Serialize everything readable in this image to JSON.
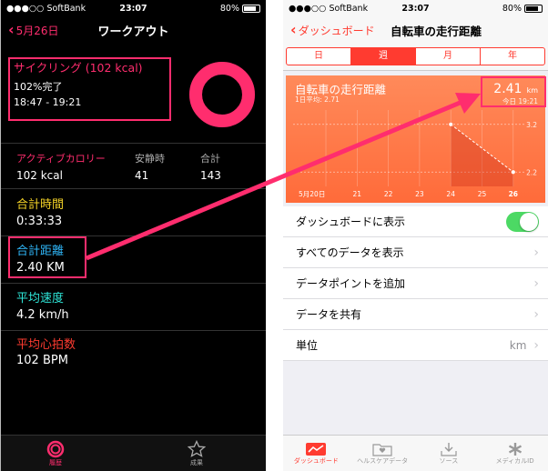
{
  "left": {
    "status": {
      "carrier": "●●●○○ SoftBank",
      "time": "23:07",
      "battery": "80%"
    },
    "nav": {
      "back": "5月26日",
      "title": "ワークアウト"
    },
    "workout": {
      "title": "サイクリング (102 kcal)",
      "completion": "102%完了",
      "time_range": "18:47 - 19:21",
      "ring_fraction": 1.02
    },
    "calories": {
      "h1": "アクティブカロリー",
      "h2": "安静時",
      "h3": "合計",
      "v1": "102 kcal",
      "v2": "41",
      "v3": "143"
    },
    "stats": [
      {
        "label": "合計時間",
        "value": "0:33:33",
        "color": "#f5d327"
      },
      {
        "label": "合計距離",
        "value": "2.40 KM",
        "color": "#2fb4f5"
      },
      {
        "label": "平均速度",
        "value": "4.2 km/h",
        "color": "#2ee6d8"
      },
      {
        "label": "平均心拍数",
        "value": "102 BPM",
        "color": "#ff3b30"
      }
    ],
    "tabs": {
      "history": "履歴",
      "achievements": "成果"
    }
  },
  "right": {
    "status": {
      "carrier": "●●●○○ SoftBank",
      "time": "23:07",
      "battery": "80%"
    },
    "nav": {
      "back": "ダッシュボード",
      "title": "自転車の走行距離"
    },
    "segments": [
      "日",
      "週",
      "月",
      "年"
    ],
    "segment_selected": "週",
    "card": {
      "title": "自転車の走行距離",
      "subtitle": "1日平均: 2.71",
      "value": "2.41",
      "unit": "km",
      "timestamp": "今日 19:21"
    },
    "chart_data": {
      "type": "line",
      "x": [
        "5月20日",
        "21",
        "22",
        "23",
        "24",
        "25",
        "26"
      ],
      "points": [
        {
          "x": "24",
          "y": 3.2
        },
        {
          "x": "26",
          "y": 2.2
        }
      ],
      "y_ticks": [
        "3.2",
        "2.2"
      ],
      "ylim": [
        1.9,
        3.5
      ]
    },
    "rows": [
      {
        "label": "ダッシュボードに表示",
        "type": "toggle"
      },
      {
        "label": "すべてのデータを表示",
        "type": "chevron"
      },
      {
        "label": "データポイントを追加",
        "type": "chevron"
      },
      {
        "label": "データを共有",
        "type": "chevron"
      },
      {
        "label": "単位",
        "type": "value",
        "value": "km"
      }
    ],
    "tabs": [
      "ダッシュボード",
      "ヘルスケアデータ",
      "ソース",
      "メディカルID"
    ]
  },
  "colors": {
    "accent_pink": "#ff2d6e",
    "health_red": "#ff3b30",
    "card_orange": "#ff7a45"
  }
}
